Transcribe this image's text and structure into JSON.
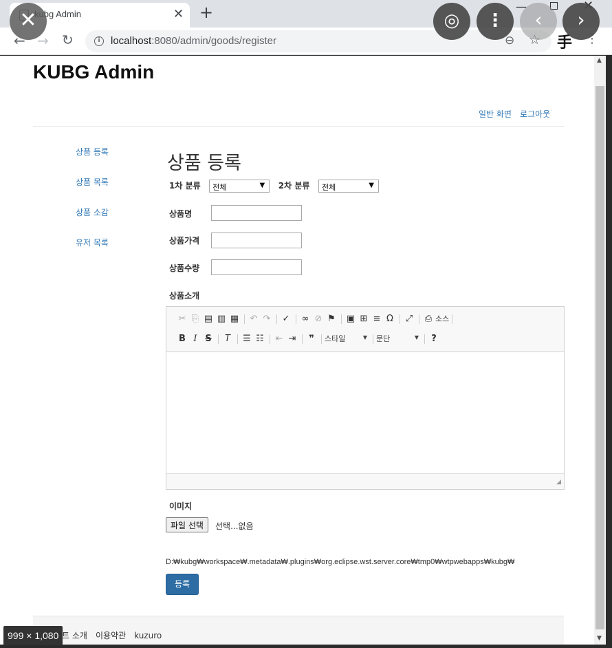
{
  "browser": {
    "tab_title": "kubg Admin",
    "url_host": "localhost",
    "url_rest": ":8080/admin/goods/register"
  },
  "overlay_icons": [
    "close-icon",
    "lens-icon",
    "more-icon",
    "chevron-left-icon",
    "chevron-right-icon"
  ],
  "header": {
    "site_title": "KUBG Admin",
    "nav": [
      "일반 화면",
      "로그아웃"
    ]
  },
  "sidebar": {
    "items": [
      {
        "label": "상품 등록"
      },
      {
        "label": "상품 목록"
      },
      {
        "label": "상품 소감"
      },
      {
        "label": "유저 목록"
      }
    ]
  },
  "form": {
    "heading": "상품 등록",
    "category1_label": "1차 분류",
    "category1_value": "전체",
    "category2_label": "2차 분류",
    "category2_value": "전체",
    "name_label": "상품명",
    "price_label": "상품가격",
    "stock_label": "상품수량",
    "description_label": "상품소개",
    "image_label": "이미지",
    "file_button": "파일 선택",
    "file_status": "선택...없음",
    "path_text": "D:₩kubg₩workspace₩.metadata₩.plugins₩org.eclipse.wst.server.core₩tmp0₩wtpwebapps₩kubg₩",
    "submit_label": "등록"
  },
  "editor": {
    "source_label": "소스",
    "style_combo": "스타일",
    "format_combo": "문단"
  },
  "footer": {
    "links": [
      "트 소개",
      "이용약관",
      "kuzuro"
    ]
  },
  "image_size_badge": "999 × 1,080",
  "colors": {
    "link": "#337ab7",
    "primary_button": "#2e6da4"
  }
}
